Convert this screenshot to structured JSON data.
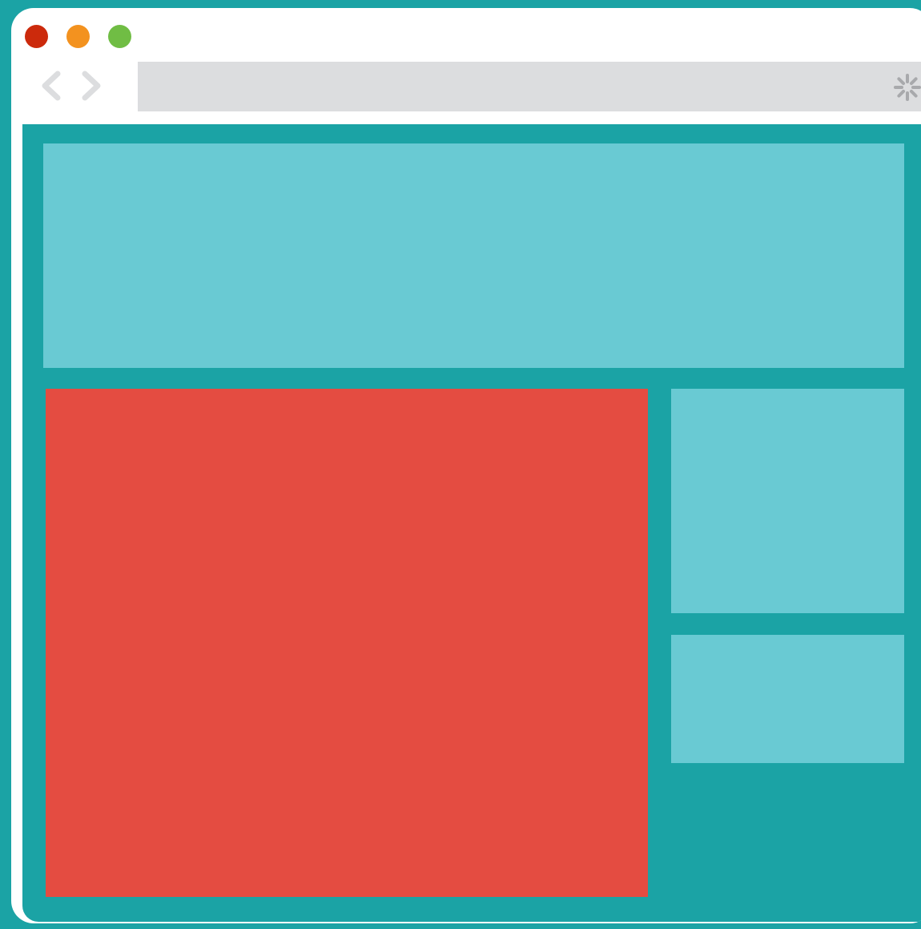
{
  "colors": {
    "background": "#1ba3a5",
    "window": "#ffffff",
    "address_bar": "#dcdddf",
    "nav_icon": "#dcdddf",
    "spinner": "#a8a9ac",
    "close": "#cc2a0c",
    "minimize": "#f3921f",
    "maximize": "#70bd44",
    "panel_light": "#69cad3",
    "panel_main": "#e44c41"
  },
  "window": {
    "controls": [
      {
        "name": "close",
        "icon": "circle"
      },
      {
        "name": "minimize",
        "icon": "circle"
      },
      {
        "name": "maximize",
        "icon": "circle"
      }
    ],
    "nav": {
      "back_icon": "chevron-left-icon",
      "forward_icon": "chevron-right-icon"
    },
    "address_bar": {
      "text": "",
      "status_icon": "loading-spinner-icon"
    }
  },
  "layout_blocks": [
    {
      "name": "header-block",
      "color": "#69cad3"
    },
    {
      "name": "main-block",
      "color": "#e44c41"
    },
    {
      "name": "sidebar-block-top",
      "color": "#69cad3"
    },
    {
      "name": "sidebar-block-bottom",
      "color": "#69cad3"
    }
  ]
}
